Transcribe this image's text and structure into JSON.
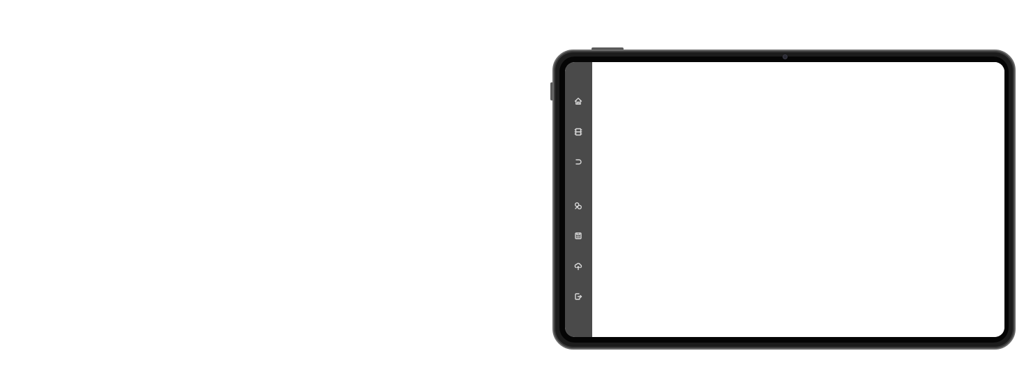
{
  "device": {
    "frame_color": "#1c1c1c",
    "screen_color": "#ffffff",
    "sidebar_color": "#4a4a4a",
    "icon_color": "#d8d8d8"
  },
  "sidebar": {
    "items": [
      {
        "icon": "home-icon"
      },
      {
        "icon": "film-icon"
      },
      {
        "icon": "undo-icon"
      },
      {
        "icon": "gallery-icon"
      },
      {
        "icon": "save-icon"
      },
      {
        "icon": "cloud-upload-icon"
      },
      {
        "icon": "export-icon"
      }
    ]
  }
}
